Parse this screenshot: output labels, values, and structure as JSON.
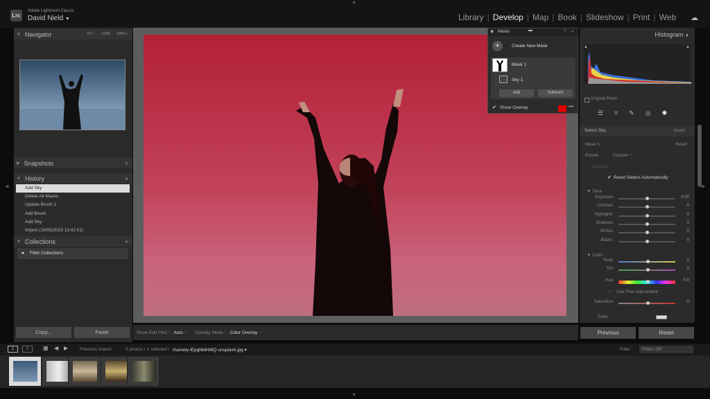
{
  "app": {
    "logo": "Lrc",
    "name": "Adobe Lightroom Classic",
    "user": "David Nield",
    "user_caret": "▼"
  },
  "modules": [
    "Library",
    "Develop",
    "Map",
    "Book",
    "Slideshow",
    "Print",
    "Web"
  ],
  "active_module": "Develop",
  "navigator": {
    "title": "Navigator",
    "fit": "FIT ÷",
    "zoom100": "100%",
    "zoom300": "300% ÷"
  },
  "snapshots": {
    "title": "Snapshots"
  },
  "history": {
    "title": "History",
    "items": [
      "Add Sky",
      "Delete All Masks",
      "Update Brush 1",
      "Add Brush",
      "Add Sky",
      "Import (16/05/2023 12:41:01)"
    ]
  },
  "collections": {
    "title": "Collections",
    "filter": "Filter Collections"
  },
  "left_buttons": {
    "copy": "Copy...",
    "paste": "Paste"
  },
  "toolbar": {
    "pins_label": "Show Edit Pins :",
    "pins_value": "Auto",
    "overlay_label": "Overlay Mode :",
    "overlay_value": "Color Overlay"
  },
  "masks": {
    "title": "Masks",
    "create": "Create New Mask",
    "mask1": "Mask 1",
    "sky1": "Sky 1",
    "add": "Add",
    "subtract": "Subtract",
    "show_overlay": "Show Overlay",
    "overlay_color": "#dd0000"
  },
  "histogram": {
    "title": "Histogram",
    "original": "Original Photo"
  },
  "select_sky": {
    "label": "Select Sky",
    "invert": "Invert"
  },
  "mask_settings": {
    "mask": "Mask 1",
    "reset": "Reset",
    "preset_label": "Preset",
    "preset_value": "Custom ÷",
    "amount_label": "Amount",
    "reset_sliders": "Reset Sliders Automatically"
  },
  "tone": {
    "title": "Tone",
    "sliders": [
      {
        "label": "Exposure",
        "value": "0.00",
        "pos": 0.5
      },
      {
        "label": "Contrast",
        "value": "0",
        "pos": 0.5
      },
      {
        "label": "Highlights",
        "value": "0",
        "pos": 0.5
      },
      {
        "label": "Shadows",
        "value": "0",
        "pos": 0.5
      },
      {
        "label": "Whites",
        "value": "0",
        "pos": 0.5
      },
      {
        "label": "Blacks",
        "value": "0",
        "pos": 0.5
      }
    ]
  },
  "color": {
    "title": "Color",
    "temp": {
      "label": "Temp",
      "value": "0"
    },
    "tint": {
      "label": "Tint",
      "value": "0"
    },
    "hue": {
      "label": "Hue",
      "value": "0.0"
    },
    "fine": "Use Fine Adjustment",
    "saturation": {
      "label": "Saturation",
      "value": "0"
    },
    "color_label": "Color"
  },
  "right_buttons": {
    "previous": "Previous",
    "reset": "Reset"
  },
  "filmstrip": {
    "page1": "1",
    "page2": "2",
    "source": "Previous Import",
    "count": "5 photos / 1 selected /",
    "filename": "rhamely-lEpgNldHt8Q-unsplash.jpg ▾",
    "filter_label": "Filter :",
    "filter_value": "Filters Off"
  }
}
